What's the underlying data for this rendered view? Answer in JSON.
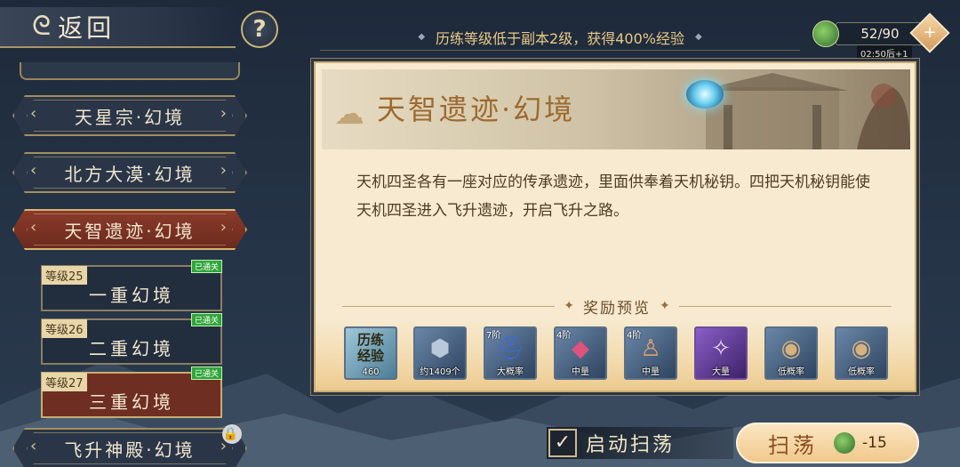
{
  "header": {
    "back_label": "返回",
    "help_label": "?",
    "notice": "历练等级低于副本2级，获得400%经验",
    "stamina": {
      "value": "52/90",
      "timer": "02:50后+1",
      "plus": "+"
    }
  },
  "dungeons": [
    {
      "name": "天星宗·幻境"
    },
    {
      "name": "北方大漠·幻境"
    },
    {
      "name": "天智遗迹·幻境"
    },
    {
      "name": "飞升神殿·幻境"
    }
  ],
  "levels": [
    {
      "level": "等级25",
      "name": "一重幻境",
      "badge": "已通关"
    },
    {
      "level": "等级26",
      "name": "二重幻境",
      "badge": "已通关"
    },
    {
      "level": "等级27",
      "name": "三重幻境",
      "badge": "已通关"
    }
  ],
  "panel": {
    "title": "天智遗迹·幻境",
    "description": "天机四圣各有一座对应的传承遗迹，里面供奉着天机秘钥。四把天机秘钥能使天机四圣进入飞升遗迹，开启飞升之路。",
    "reward_title": "奖励预览"
  },
  "rewards": [
    {
      "exp_line1": "历练",
      "exp_line2": "经验",
      "qty": "460",
      "tier": ""
    },
    {
      "qty": "约1409个",
      "tier": ""
    },
    {
      "qty": "大概率",
      "tier": "7阶"
    },
    {
      "qty": "中量",
      "tier": "4阶"
    },
    {
      "qty": "中量",
      "tier": "4阶"
    },
    {
      "qty": "大量",
      "tier": ""
    },
    {
      "qty": "低概率",
      "tier": ""
    },
    {
      "qty": "低概率",
      "tier": ""
    }
  ],
  "footer": {
    "auto_sweep_label": "启动扫荡",
    "sweep_label": "扫荡",
    "sweep_cost": "-15"
  },
  "colors": {
    "accent_gold": "#c9ad72",
    "active_red": "#6e2e22",
    "passed_green": "#2fa53a",
    "panel_bg": "#f7ead0"
  }
}
